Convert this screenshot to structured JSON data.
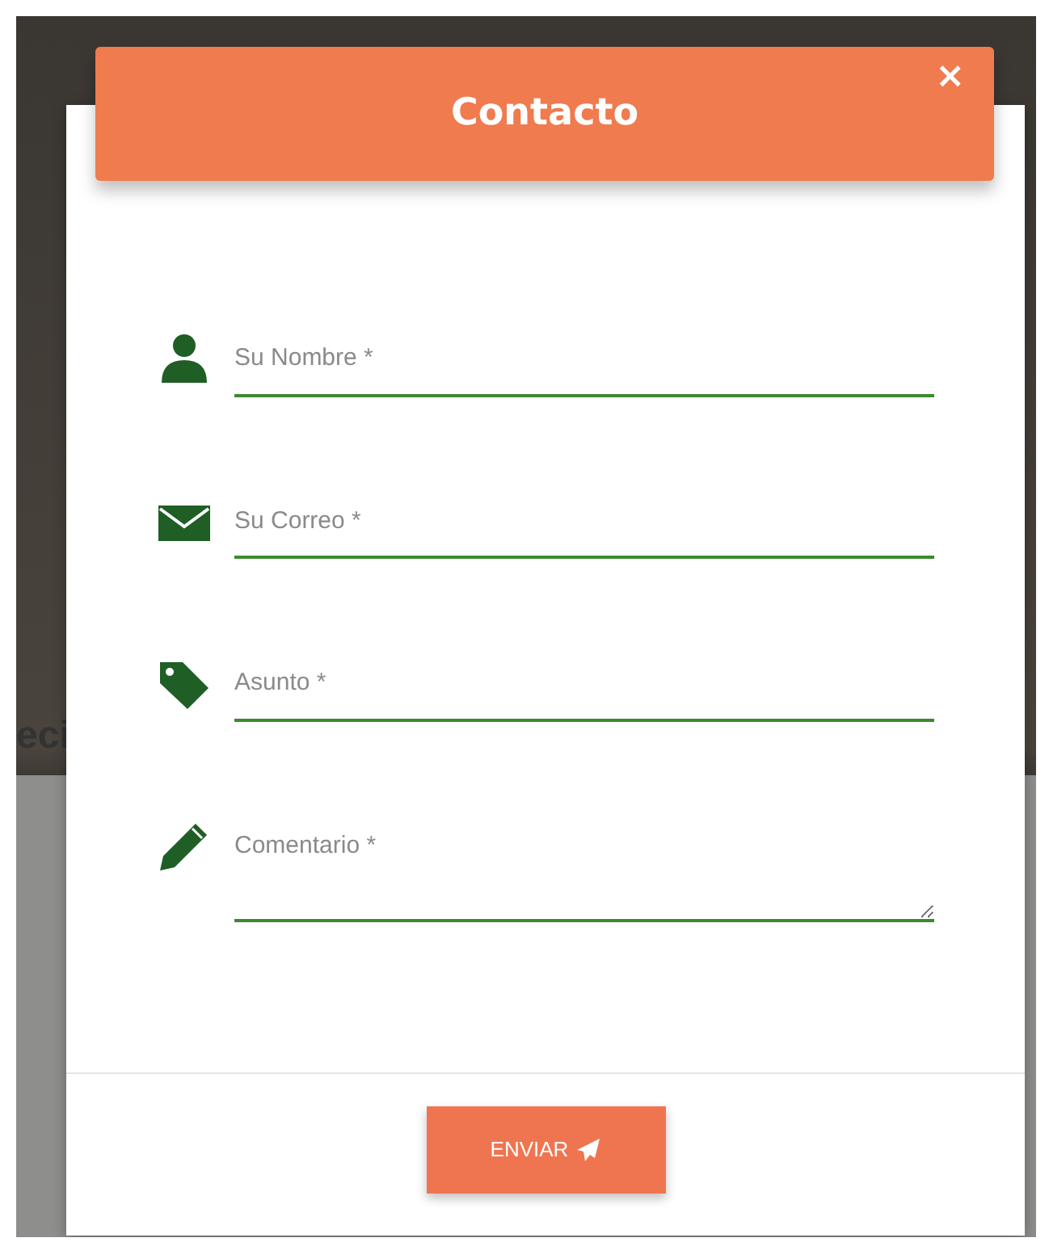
{
  "background_text": "eci",
  "modal": {
    "title": "Contacto",
    "close": "×",
    "fields": [
      {
        "kind": "input",
        "placeholder": "Su Nombre *"
      },
      {
        "kind": "input",
        "placeholder": "Su Correo *"
      },
      {
        "kind": "input",
        "placeholder": "Asunto *"
      },
      {
        "kind": "textarea",
        "placeholder": "Comentario *"
      }
    ],
    "submit": "ENVIAR"
  }
}
